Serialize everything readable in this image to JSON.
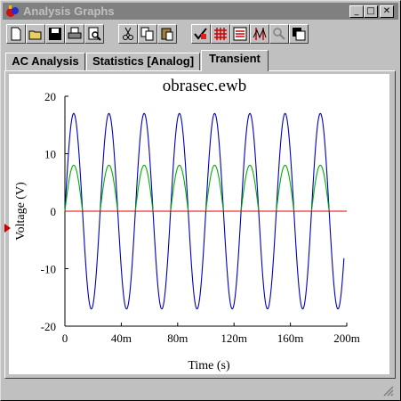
{
  "window": {
    "title": "Analysis Graphs"
  },
  "caption_buttons": {
    "minimize": "_",
    "maximize": "□",
    "close": "✕"
  },
  "toolbar": {
    "buttons": [
      "new-icon",
      "open-icon",
      "save-icon",
      "print-icon",
      "print-preview-icon",
      "cut-icon",
      "copy-icon",
      "paste-icon",
      "properties-icon",
      "grid-icon",
      "legend-icon",
      "cursors-icon",
      "zoom-icon",
      "reverse-colors-icon"
    ]
  },
  "tabs": [
    {
      "label": "AC Analysis"
    },
    {
      "label": "Statistics [Analog]"
    },
    {
      "label": "Transient",
      "active": true
    }
  ],
  "chart_data": {
    "type": "line",
    "title": "obrasec.ewb",
    "xlabel": "Time (s)",
    "ylabel": "Voltage (V)",
    "xlim": [
      0,
      0.2
    ],
    "ylim": [
      -20,
      20
    ],
    "xticks": [
      "0",
      "40m",
      "80m",
      "120m",
      "160m",
      "200m"
    ],
    "yticks": [
      "20",
      "10",
      "0",
      "-10",
      "-20"
    ],
    "series": [
      {
        "color": "#0000c0",
        "kind": "sine",
        "amplitude": 17,
        "frequency_hz": 40,
        "x_end": 0.198
      },
      {
        "color": "#00b000",
        "kind": "half-wave",
        "amplitude": 8,
        "frequency_hz": 40,
        "x_end": 0.2
      },
      {
        "color": "#e00000",
        "kind": "constant",
        "value": 0,
        "x_end": 0.2
      }
    ],
    "grid": false
  }
}
